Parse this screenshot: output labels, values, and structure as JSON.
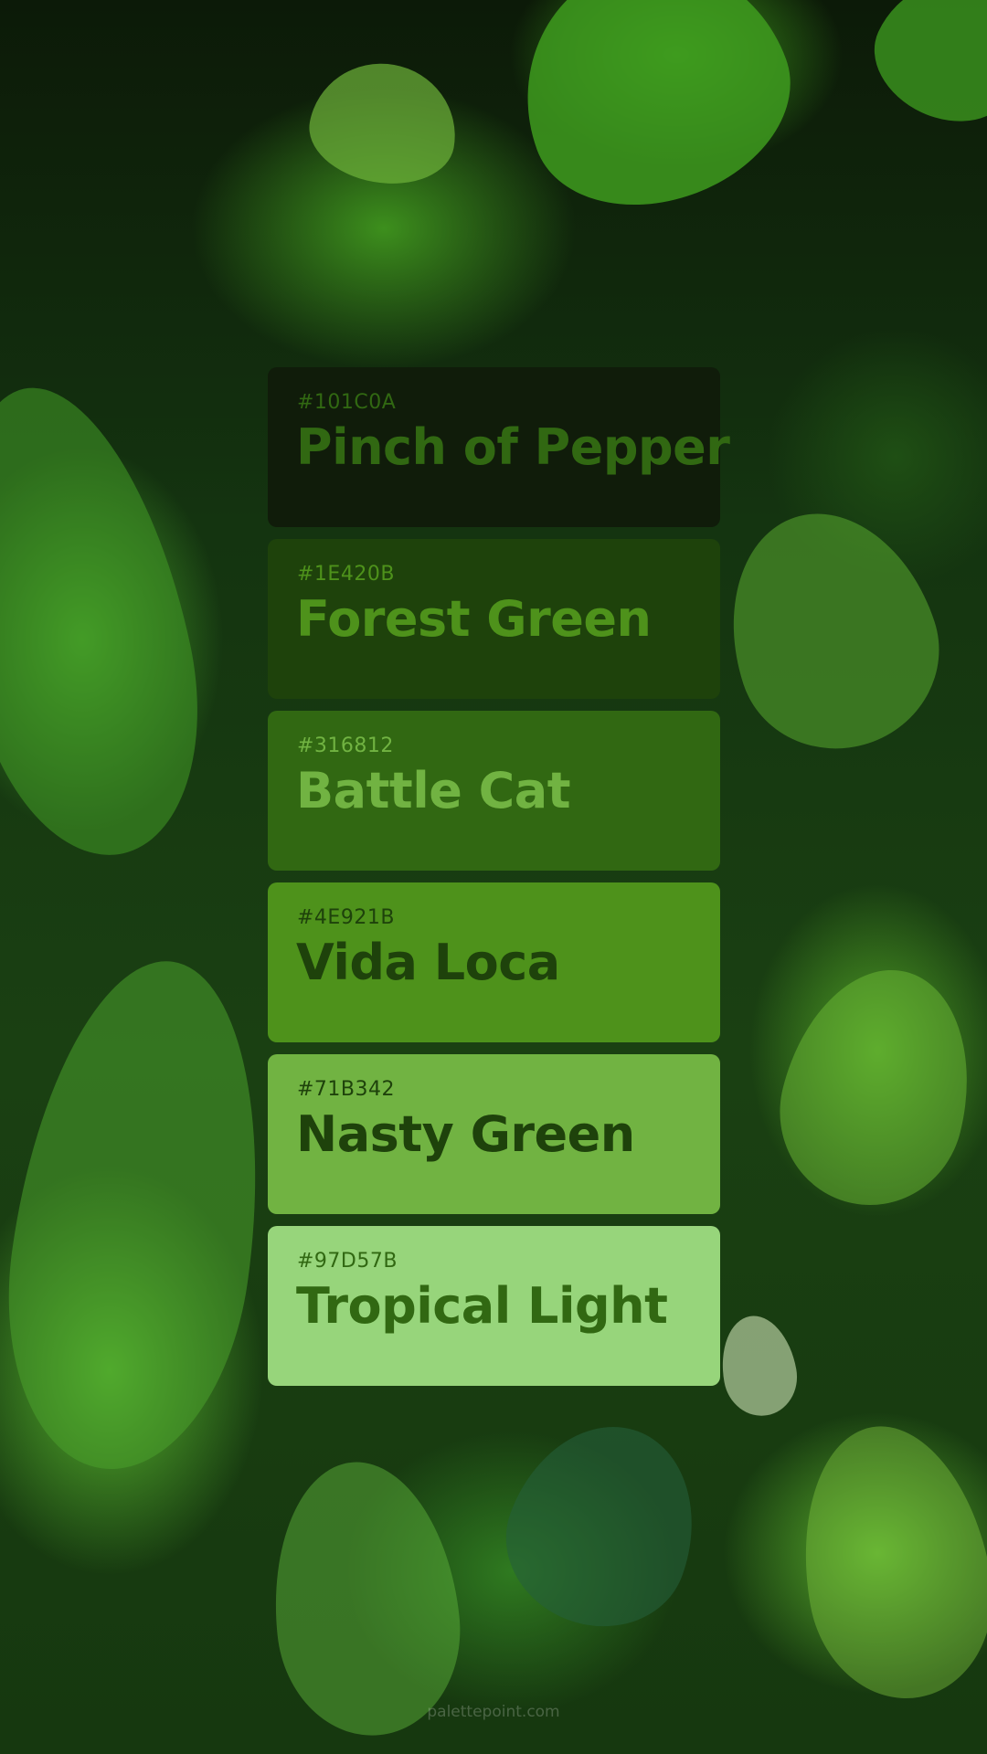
{
  "background": {
    "description_icon": "jungle-ferns-image",
    "accent": "#316812"
  },
  "palette": [
    {
      "hex": "#101C0A",
      "name": "Pinch of Pepper",
      "bg": "#101C0A",
      "text": "#316812"
    },
    {
      "hex": "#1E420B",
      "name": "Forest Green",
      "bg": "#1E420B",
      "text": "#4E921B"
    },
    {
      "hex": "#316812",
      "name": "Battle Cat",
      "bg": "#316812",
      "text": "#71B342"
    },
    {
      "hex": "#4E921B",
      "name": "Vida Loca",
      "bg": "#4E921B",
      "text": "#1E420B"
    },
    {
      "hex": "#71B342",
      "name": "Nasty Green",
      "bg": "#71B342",
      "text": "#1E420B"
    },
    {
      "hex": "#97D57B",
      "name": "Tropical Light",
      "bg": "#97D57B",
      "text": "#316812"
    }
  ],
  "footer": {
    "watermark": "palettepoint.com"
  }
}
